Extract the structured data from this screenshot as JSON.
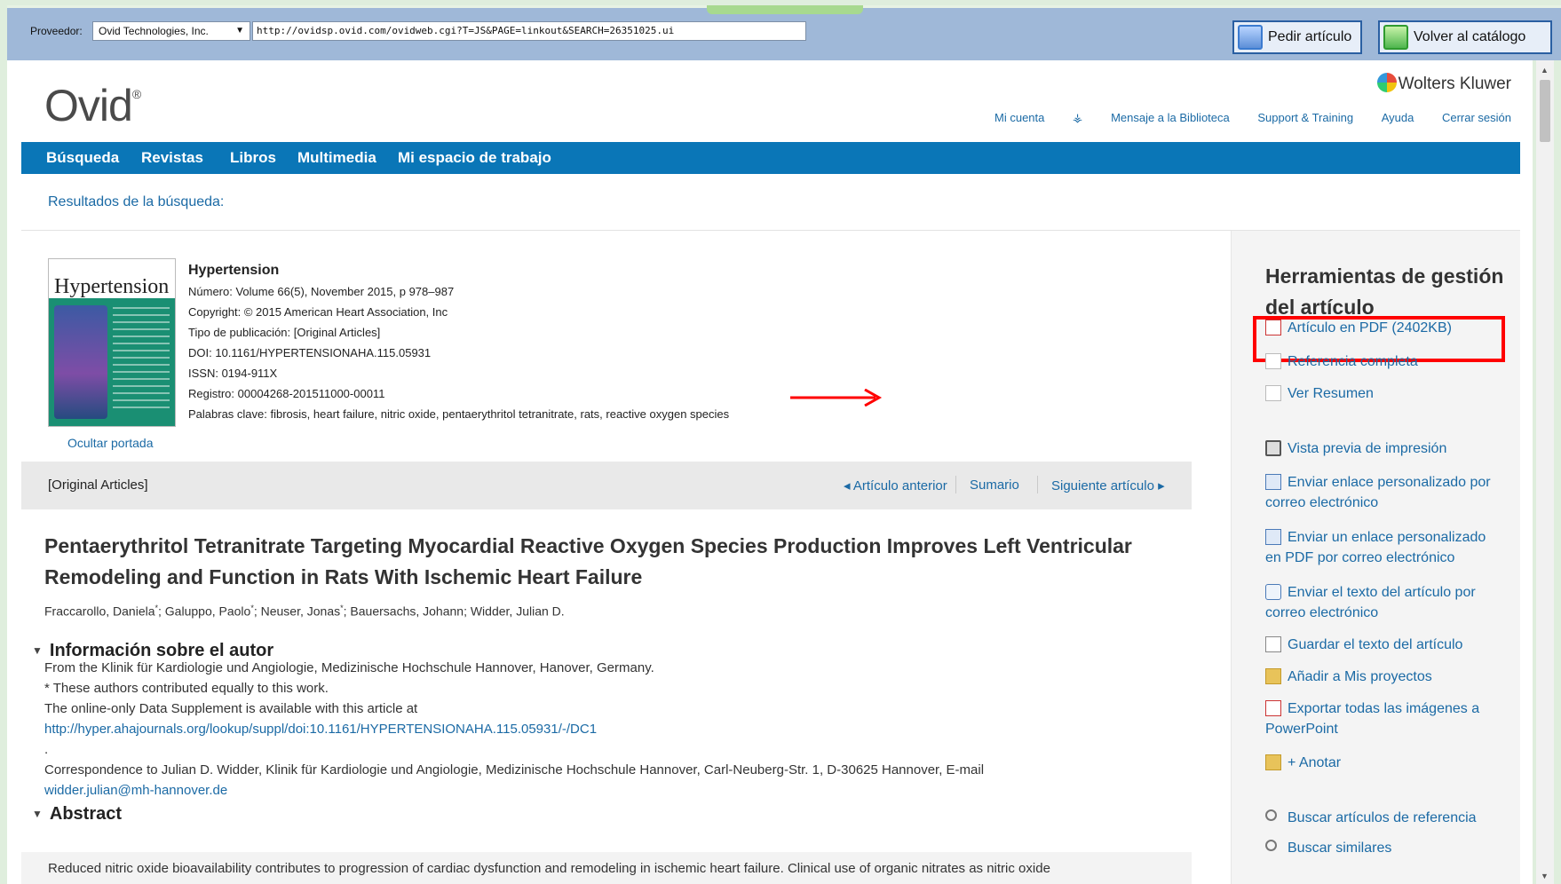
{
  "provider_bar": {
    "label": "Proveedor:",
    "provider": "Ovid Technologies, Inc.",
    "url": "http://ovidsp.ovid.com/ovidweb.cgi?T=JS&PAGE=linkout&SEARCH=26351025.ui",
    "order_button": "Pedir artículo",
    "back_button": "Volver al catálogo"
  },
  "header": {
    "logo": "Ovid",
    "logo_mark": "®",
    "brand": "Wolters Kluwer",
    "links": [
      "Mi cuenta",
      "Mensaje a la Biblioteca",
      "Support & Training",
      "Ayuda",
      "Cerrar sesión"
    ]
  },
  "nav": [
    "Búsqueda",
    "Revistas",
    "Libros",
    "Multimedia",
    "Mi espacio de trabajo"
  ],
  "breadcrumb": "Resultados de la búsqueda:",
  "article_meta": {
    "journal": "Hypertension",
    "cover_title": "Hypertension",
    "number": "Número: Volume 66(5), November 2015, p 978–987",
    "copyright": "Copyright: © 2015 American Heart Association, Inc",
    "pub_type": "Tipo de publicación: [Original Articles]",
    "doi": "DOI: 10.1161/HYPERTENSIONAHA.115.05931",
    "issn": "ISSN: 0194-911X",
    "registro": "Registro: 00004268-201511000-00011",
    "keywords": "Palabras clave: fibrosis, heart failure, nitric oxide, pentaerythritol tetranitrate, rats, reactive oxygen species",
    "hide_cover": "Ocultar portada"
  },
  "article_nav": {
    "type": "[Original Articles]",
    "prev": "◂ Artículo anterior",
    "toc": "Sumario",
    "next": "Siguiente artículo ▸"
  },
  "article": {
    "title": "Pentaerythritol Tetranitrate Targeting Myocardial Reactive Oxygen Species Production Improves Left Ventricular Remodeling and Function in Rats With Ischemic Heart Failure",
    "authors": [
      {
        "name": "Fraccarollo, Daniela",
        "mark": "*"
      },
      {
        "name": "Galuppo, Paolo",
        "mark": "*"
      },
      {
        "name": "Neuser, Jonas",
        "mark": "*"
      },
      {
        "name": "Bauersachs, Johann",
        "mark": ""
      },
      {
        "name": "Widder, Julian D.",
        "mark": ""
      }
    ],
    "author_info_heading": "Información sobre el autor",
    "author_info_lines": [
      "From the Klinik für Kardiologie und Angiologie, Medizinische Hochschule Hannover, Hanover, Germany.",
      "* These authors contributed equally to this work.",
      "The online-only Data Supplement is available with this article at"
    ],
    "supplement_link": "http://hyper.ahajournals.org/lookup/suppl/doi:10.1161/HYPERTENSIONAHA.115.05931/-/DC1",
    "dot": ".",
    "correspondence": "Correspondence to Julian D. Widder, Klinik für Kardiologie und Angiologie, Medizinische Hochschule Hannover, Carl-Neuberg-Str. 1, D-30625 Hannover, E-mail",
    "email": "widder.julian@mh-hannover.de",
    "abstract_heading": "Abstract",
    "abstract_start": "Reduced nitric oxide bioavailability contributes to progression of cardiac dysfunction and remodeling in ischemic heart failure. Clinical use of organic nitrates as nitric oxide"
  },
  "sidebar": {
    "title": "Herramientas de gestión del artículo",
    "tools": [
      {
        "label": "Artículo en PDF (2402KB)",
        "icon": "pdf-icon"
      },
      {
        "label": "Referencia completa",
        "icon": "document-icon"
      },
      {
        "label": "Ver Resumen",
        "icon": "page-icon"
      },
      {
        "label": "Vista previa de impresión",
        "icon": "printer-icon"
      },
      {
        "label": "Enviar enlace personalizado por correo electrónico",
        "icon": "email-link-icon"
      },
      {
        "label": "Enviar un enlace personalizado en PDF por correo electrónico",
        "icon": "email-pdf-icon"
      },
      {
        "label": "Enviar el texto del artículo por correo electrónico",
        "icon": "email-text-icon"
      },
      {
        "label": "Guardar el texto del artículo",
        "icon": "save-icon"
      },
      {
        "label": "Añadir a Mis proyectos",
        "icon": "folder-add-icon"
      },
      {
        "label": "Exportar todas las imágenes a PowerPoint",
        "icon": "powerpoint-icon"
      },
      {
        "label": "+ Anotar",
        "icon": "annotate-icon"
      },
      {
        "label": "Buscar artículos de referencia",
        "icon": "search-icon"
      },
      {
        "label": "Buscar similares",
        "icon": "search-similar-icon"
      }
    ]
  },
  "colors": {
    "nav_blue": "#0a76b7",
    "link_blue": "#1b6aa5",
    "highlight_red": "#ff0000"
  }
}
